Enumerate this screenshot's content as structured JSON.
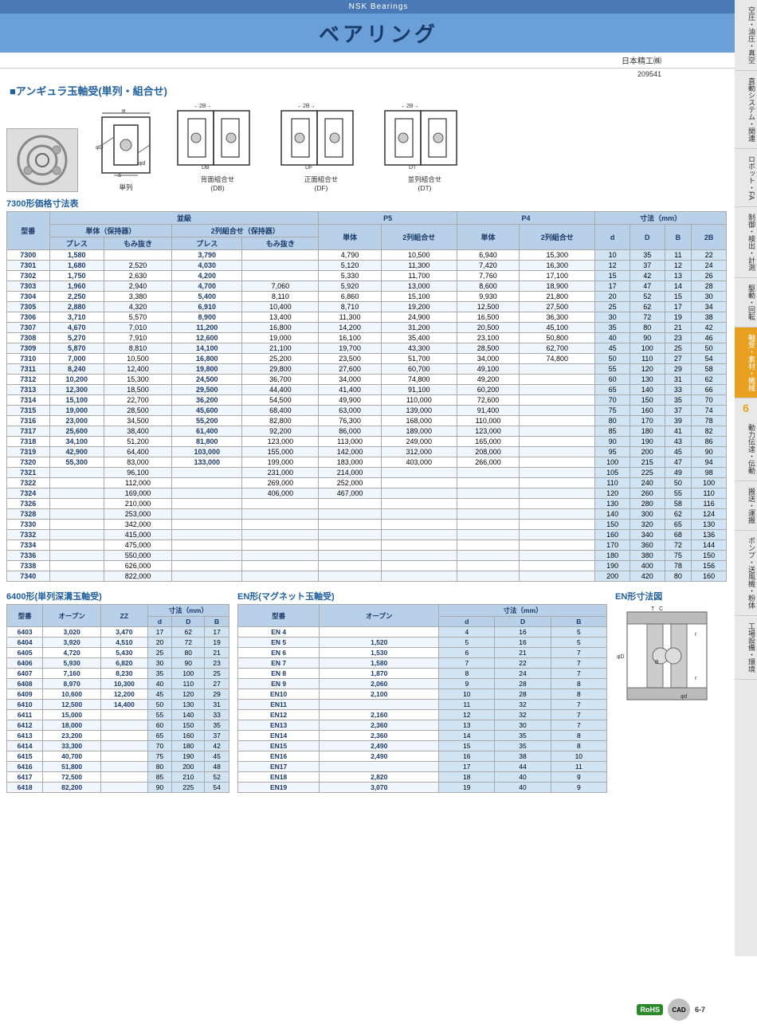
{
  "header": {
    "brand": "NSK Bearings",
    "title": "ベアリング",
    "company": "日本精工㈱",
    "doc_number": "209541"
  },
  "sidebar": {
    "items": [
      {
        "label": "空圧・油圧・真空"
      },
      {
        "label": "直動システム・関連"
      },
      {
        "label": "ロボット・FA"
      },
      {
        "label": "制御・検出・計測"
      },
      {
        "label": "駆動・回転"
      },
      {
        "label": "軸受・素材・機械",
        "active": true
      },
      {
        "label": "動力伝達・伝動"
      },
      {
        "label": "搬送・運搬"
      },
      {
        "label": "ポンプ・送風機・粉体"
      },
      {
        "label": "工場設備・環境"
      }
    ],
    "section_num": "6"
  },
  "section_title": "■アンギュラ玉軸受(単列・組合せ)",
  "diagrams": [
    {
      "label": "単列"
    },
    {
      "label": "背面組合せ\n(DB)"
    },
    {
      "label": "正面組合せ\n(DF)"
    },
    {
      "label": "並列組合せ\n(DT)"
    }
  ],
  "table7300": {
    "title": "7300形価格寸法表",
    "headers": {
      "model": "型番",
      "grade_label": "並級",
      "single_label": "単体（保持器）",
      "press": "プレス",
      "morinuki": "もみ抜き",
      "double_label": "2列組合せ（保持器）",
      "press2": "プレス",
      "morinuki2": "もみ抜き",
      "p5_label": "P5",
      "p5_single": "単体",
      "p5_double": "2列組合せ",
      "p4_label": "P4",
      "p4_single": "単体",
      "p4_double": "2列組合せ",
      "dim_label": "寸法（mm）",
      "d": "d",
      "D": "D",
      "B": "B",
      "B2": "2B"
    },
    "rows": [
      {
        "model": "7300",
        "press": "1,580",
        "morinuki": "",
        "press2": "3,790",
        "morinuki2": "",
        "p5s": "4,790",
        "p5d": "10,500",
        "p4s": "6,940",
        "p4d": "15,300",
        "d": "10",
        "D": "35",
        "B": "11",
        "B2": "22"
      },
      {
        "model": "7301",
        "press": "1,680",
        "morinuki": "2,520",
        "press2": "4,030",
        "morinuki2": "",
        "p5s": "5,120",
        "p5d": "11,300",
        "p4s": "7,420",
        "p4d": "16,300",
        "d": "12",
        "D": "37",
        "B": "12",
        "B2": "24"
      },
      {
        "model": "7302",
        "press": "1,750",
        "morinuki": "2,630",
        "press2": "4,200",
        "morinuki2": "",
        "p5s": "5,330",
        "p5d": "11,700",
        "p4s": "7,760",
        "p4d": "17,100",
        "d": "15",
        "D": "42",
        "B": "13",
        "B2": "26"
      },
      {
        "model": "7303",
        "press": "1,960",
        "morinuki": "2,940",
        "press2": "4,700",
        "morinuki2": "7,060",
        "p5s": "5,920",
        "p5d": "13,000",
        "p4s": "8,600",
        "p4d": "18,900",
        "d": "17",
        "D": "47",
        "B": "14",
        "B2": "28"
      },
      {
        "model": "7304",
        "press": "2,250",
        "morinuki": "3,380",
        "press2": "5,400",
        "morinuki2": "8,110",
        "p5s": "6,860",
        "p5d": "15,100",
        "p4s": "9,930",
        "p4d": "21,800",
        "d": "20",
        "D": "52",
        "B": "15",
        "B2": "30"
      },
      {
        "model": "7305",
        "press": "2,880",
        "morinuki": "4,320",
        "press2": "6,910",
        "morinuki2": "10,400",
        "p5s": "8,710",
        "p5d": "19,200",
        "p4s": "12,500",
        "p4d": "27,500",
        "d": "25",
        "D": "62",
        "B": "17",
        "B2": "34"
      },
      {
        "model": "7306",
        "press": "3,710",
        "morinuki": "5,570",
        "press2": "8,900",
        "morinuki2": "13,400",
        "p5s": "11,300",
        "p5d": "24,900",
        "p4s": "16,500",
        "p4d": "36,300",
        "d": "30",
        "D": "72",
        "B": "19",
        "B2": "38"
      },
      {
        "model": "7307",
        "press": "4,670",
        "morinuki": "7,010",
        "press2": "11,200",
        "morinuki2": "16,800",
        "p5s": "14,200",
        "p5d": "31,200",
        "p4s": "20,500",
        "p4d": "45,100",
        "d": "35",
        "D": "80",
        "B": "21",
        "B2": "42"
      },
      {
        "model": "7308",
        "press": "5,270",
        "morinuki": "7,910",
        "press2": "12,600",
        "morinuki2": "19,000",
        "p5s": "16,100",
        "p5d": "35,400",
        "p4s": "23,100",
        "p4d": "50,800",
        "d": "40",
        "D": "90",
        "B": "23",
        "B2": "46"
      },
      {
        "model": "7309",
        "press": "5,870",
        "morinuki": "8,810",
        "press2": "14,100",
        "morinuki2": "21,100",
        "p5s": "19,700",
        "p5d": "43,300",
        "p4s": "28,500",
        "p4d": "62,700",
        "d": "45",
        "D": "100",
        "B": "25",
        "B2": "50"
      },
      {
        "model": "7310",
        "press": "7,000",
        "morinuki": "10,500",
        "press2": "16,800",
        "morinuki2": "25,200",
        "p5s": "23,500",
        "p5d": "51,700",
        "p4s": "34,000",
        "p4d": "74,800",
        "d": "50",
        "D": "110",
        "B": "27",
        "B2": "54"
      },
      {
        "model": "7311",
        "press": "8,240",
        "morinuki": "12,400",
        "press2": "19,800",
        "morinuki2": "29,800",
        "p5s": "27,600",
        "p5d": "60,700",
        "p4s": "49,100",
        "p4d": "",
        "d": "55",
        "D": "120",
        "B": "29",
        "B2": "58"
      },
      {
        "model": "7312",
        "press": "10,200",
        "morinuki": "15,300",
        "press2": "24,500",
        "morinuki2": "36,700",
        "p5s": "34,000",
        "p5d": "74,800",
        "p4s": "49,200",
        "p4d": "",
        "d": "60",
        "D": "130",
        "B": "31",
        "B2": "62"
      },
      {
        "model": "7313",
        "press": "12,300",
        "morinuki": "18,500",
        "press2": "29,500",
        "morinuki2": "44,400",
        "p5s": "41,400",
        "p5d": "91,100",
        "p4s": "60,200",
        "p4d": "",
        "d": "65",
        "D": "140",
        "B": "33",
        "B2": "66"
      },
      {
        "model": "7314",
        "press": "15,100",
        "morinuki": "22,700",
        "press2": "36,200",
        "morinuki2": "54,500",
        "p5s": "49,900",
        "p5d": "110,000",
        "p4s": "72,600",
        "p4d": "",
        "d": "70",
        "D": "150",
        "B": "35",
        "B2": "70"
      },
      {
        "model": "7315",
        "press": "19,000",
        "morinuki": "28,500",
        "press2": "45,600",
        "morinuki2": "68,400",
        "p5s": "63,000",
        "p5d": "139,000",
        "p4s": "91,400",
        "p4d": "",
        "d": "75",
        "D": "160",
        "B": "37",
        "B2": "74"
      },
      {
        "model": "7316",
        "press": "23,000",
        "morinuki": "34,500",
        "press2": "55,200",
        "morinuki2": "82,800",
        "p5s": "76,300",
        "p5d": "168,000",
        "p4s": "110,000",
        "p4d": "",
        "d": "80",
        "D": "170",
        "B": "39",
        "B2": "78"
      },
      {
        "model": "7317",
        "press": "25,600",
        "morinuki": "38,400",
        "press2": "61,400",
        "morinuki2": "92,200",
        "p5s": "86,000",
        "p5d": "189,000",
        "p4s": "123,000",
        "p4d": "",
        "d": "85",
        "D": "180",
        "B": "41",
        "B2": "82"
      },
      {
        "model": "7318",
        "press": "34,100",
        "morinuki": "51,200",
        "press2": "81,800",
        "morinuki2": "123,000",
        "p5s": "113,000",
        "p5d": "249,000",
        "p4s": "165,000",
        "p4d": "",
        "d": "90",
        "D": "190",
        "B": "43",
        "B2": "86"
      },
      {
        "model": "7319",
        "press": "42,900",
        "morinuki": "64,400",
        "press2": "103,000",
        "morinuki2": "155,000",
        "p5s": "142,000",
        "p5d": "312,000",
        "p4s": "208,000",
        "p4d": "",
        "d": "95",
        "D": "200",
        "B": "45",
        "B2": "90"
      },
      {
        "model": "7320",
        "press": "55,300",
        "morinuki": "83,000",
        "press2": "133,000",
        "morinuki2": "199,000",
        "p5s": "183,000",
        "p5d": "403,000",
        "p4s": "266,000",
        "p4d": "",
        "d": "100",
        "D": "215",
        "B": "47",
        "B2": "94"
      },
      {
        "model": "7321",
        "press": "",
        "morinuki": "96,100",
        "press2": "",
        "morinuki2": "231,000",
        "p5s": "214,000",
        "p5d": "",
        "p4s": "",
        "p4d": "",
        "d": "105",
        "D": "225",
        "B": "49",
        "B2": "98"
      },
      {
        "model": "7322",
        "press": "",
        "morinuki": "112,000",
        "press2": "",
        "morinuki2": "269,000",
        "p5s": "252,000",
        "p5d": "",
        "p4s": "",
        "p4d": "",
        "d": "110",
        "D": "240",
        "B": "50",
        "B2": "100"
      },
      {
        "model": "7324",
        "press": "",
        "morinuki": "169,000",
        "press2": "",
        "morinuki2": "406,000",
        "p5s": "467,000",
        "p5d": "",
        "p4s": "",
        "p4d": "",
        "d": "120",
        "D": "260",
        "B": "55",
        "B2": "110"
      },
      {
        "model": "7326",
        "press": "",
        "morinuki": "210,000",
        "press2": "",
        "morinuki2": "",
        "p5s": "",
        "p5d": "",
        "p4s": "",
        "p4d": "",
        "d": "130",
        "D": "280",
        "B": "58",
        "B2": "116"
      },
      {
        "model": "7328",
        "press": "",
        "morinuki": "253,000",
        "press2": "",
        "morinuki2": "",
        "p5s": "",
        "p5d": "",
        "p4s": "",
        "p4d": "",
        "d": "140",
        "D": "300",
        "B": "62",
        "B2": "124"
      },
      {
        "model": "7330",
        "press": "",
        "morinuki": "342,000",
        "press2": "",
        "morinuki2": "",
        "p5s": "",
        "p5d": "",
        "p4s": "",
        "p4d": "",
        "d": "150",
        "D": "320",
        "B": "65",
        "B2": "130"
      },
      {
        "model": "7332",
        "press": "",
        "morinuki": "415,000",
        "press2": "",
        "morinuki2": "",
        "p5s": "",
        "p5d": "",
        "p4s": "",
        "p4d": "",
        "d": "160",
        "D": "340",
        "B": "68",
        "B2": "136"
      },
      {
        "model": "7334",
        "press": "",
        "morinuki": "475,000",
        "press2": "",
        "morinuki2": "",
        "p5s": "",
        "p5d": "",
        "p4s": "",
        "p4d": "",
        "d": "170",
        "D": "360",
        "B": "72",
        "B2": "144"
      },
      {
        "model": "7336",
        "press": "",
        "morinuki": "550,000",
        "press2": "",
        "morinuki2": "",
        "p5s": "",
        "p5d": "",
        "p4s": "",
        "p4d": "",
        "d": "180",
        "D": "380",
        "B": "75",
        "B2": "150"
      },
      {
        "model": "7338",
        "press": "",
        "morinuki": "626,000",
        "press2": "",
        "morinuki2": "",
        "p5s": "",
        "p5d": "",
        "p4s": "",
        "p4d": "",
        "d": "190",
        "D": "400",
        "B": "78",
        "B2": "156"
      },
      {
        "model": "7340",
        "press": "",
        "morinuki": "822,000",
        "press2": "",
        "morinuki2": "",
        "p5s": "",
        "p5d": "",
        "p4s": "",
        "p4d": "",
        "d": "200",
        "D": "420",
        "B": "80",
        "B2": "160"
      }
    ]
  },
  "table6400": {
    "title": "6400形(単列深溝玉軸受)",
    "headers": {
      "model": "型番",
      "open": "オープン",
      "zz": "ZZ",
      "d": "d",
      "D": "D",
      "B": "B"
    },
    "rows": [
      {
        "model": "6403",
        "open": "3,020",
        "zz": "3,470",
        "d": "17",
        "D": "62",
        "B": "17"
      },
      {
        "model": "6404",
        "open": "3,920",
        "zz": "4,510",
        "d": "20",
        "D": "72",
        "B": "19"
      },
      {
        "model": "6405",
        "open": "4,720",
        "zz": "5,430",
        "d": "25",
        "D": "80",
        "B": "21"
      },
      {
        "model": "6406",
        "open": "5,930",
        "zz": "6,820",
        "d": "30",
        "D": "90",
        "B": "23"
      },
      {
        "model": "6407",
        "open": "7,160",
        "zz": "8,230",
        "d": "35",
        "D": "100",
        "B": "25"
      },
      {
        "model": "6408",
        "open": "8,970",
        "zz": "10,300",
        "d": "40",
        "D": "110",
        "B": "27"
      },
      {
        "model": "6409",
        "open": "10,600",
        "zz": "12,200",
        "d": "45",
        "D": "120",
        "B": "29"
      },
      {
        "model": "6410",
        "open": "12,500",
        "zz": "14,400",
        "d": "50",
        "D": "130",
        "B": "31"
      },
      {
        "model": "6411",
        "open": "15,000",
        "zz": "",
        "d": "55",
        "D": "140",
        "B": "33"
      },
      {
        "model": "6412",
        "open": "18,000",
        "zz": "",
        "d": "60",
        "D": "150",
        "B": "35"
      },
      {
        "model": "6413",
        "open": "23,200",
        "zz": "",
        "d": "65",
        "D": "160",
        "B": "37"
      },
      {
        "model": "6414",
        "open": "33,300",
        "zz": "",
        "d": "70",
        "D": "180",
        "B": "42"
      },
      {
        "model": "6415",
        "open": "40,700",
        "zz": "",
        "d": "75",
        "D": "190",
        "B": "45"
      },
      {
        "model": "6416",
        "open": "51,800",
        "zz": "",
        "d": "80",
        "D": "200",
        "B": "48"
      },
      {
        "model": "6417",
        "open": "72,500",
        "zz": "",
        "d": "85",
        "D": "210",
        "B": "52"
      },
      {
        "model": "6418",
        "open": "82,200",
        "zz": "",
        "d": "90",
        "D": "225",
        "B": "54"
      }
    ]
  },
  "tableEN": {
    "title": "EN形(マグネット玉軸受)",
    "dim_title": "EN形寸法図",
    "headers": {
      "model": "型番",
      "open": "オープン",
      "d": "d",
      "D": "D",
      "B": "B"
    },
    "rows": [
      {
        "model": "EN 4",
        "open": "",
        "d": "4",
        "D": "16",
        "B": "5"
      },
      {
        "model": "EN 5",
        "open": "1,520",
        "d": "5",
        "D": "16",
        "B": "5"
      },
      {
        "model": "EN 6",
        "open": "1,530",
        "d": "6",
        "D": "21",
        "B": "7"
      },
      {
        "model": "EN 7",
        "open": "1,580",
        "d": "7",
        "D": "22",
        "B": "7"
      },
      {
        "model": "EN 8",
        "open": "1,870",
        "d": "8",
        "D": "24",
        "B": "7"
      },
      {
        "model": "EN 9",
        "open": "2,060",
        "d": "9",
        "D": "28",
        "B": "8"
      },
      {
        "model": "EN10",
        "open": "2,100",
        "d": "10",
        "D": "28",
        "B": "8"
      },
      {
        "model": "EN11",
        "open": "",
        "d": "11",
        "D": "32",
        "B": "7"
      },
      {
        "model": "EN12",
        "open": "2,160",
        "d": "12",
        "D": "32",
        "B": "7"
      },
      {
        "model": "EN13",
        "open": "2,360",
        "d": "13",
        "D": "30",
        "B": "7"
      },
      {
        "model": "EN14",
        "open": "2,360",
        "d": "14",
        "D": "35",
        "B": "8"
      },
      {
        "model": "EN15",
        "open": "2,490",
        "d": "15",
        "D": "35",
        "B": "8"
      },
      {
        "model": "EN16",
        "open": "2,490",
        "d": "16",
        "D": "38",
        "B": "10"
      },
      {
        "model": "EN17",
        "open": "",
        "d": "17",
        "D": "44",
        "B": "11"
      },
      {
        "model": "EN18",
        "open": "2,820",
        "d": "18",
        "D": "40",
        "B": "9"
      },
      {
        "model": "EN19",
        "open": "3,070",
        "d": "19",
        "D": "40",
        "B": "9"
      }
    ]
  },
  "footer": {
    "rohs": "RoHS",
    "cad": "CAD",
    "page": "6-7"
  }
}
